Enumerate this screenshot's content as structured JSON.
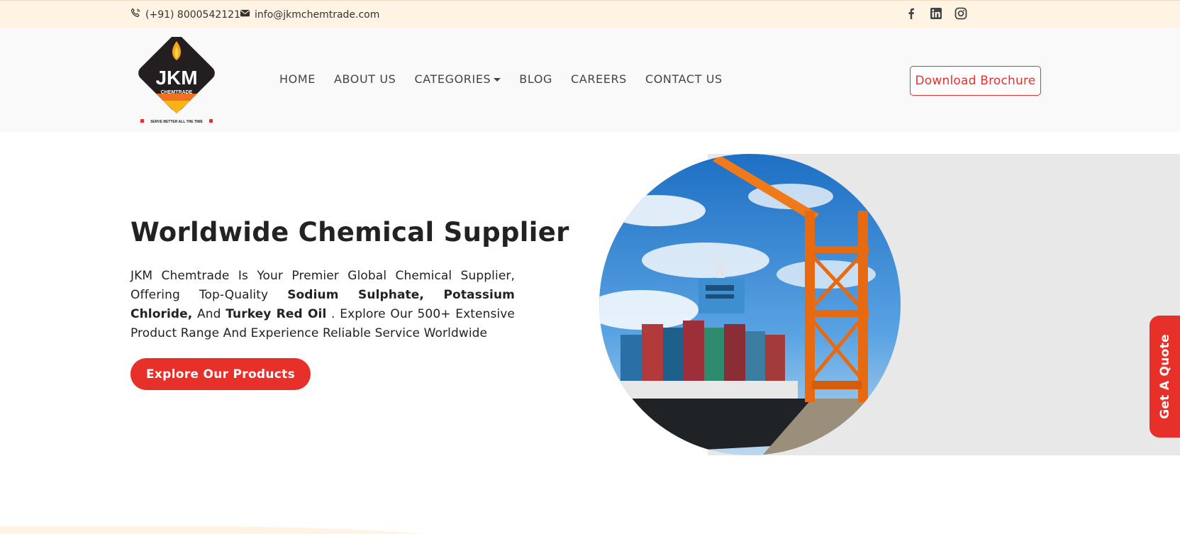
{
  "topbar": {
    "phone": "(+91) 8000542121",
    "email": "info@jkmchemtrade.com",
    "socials": [
      "facebook-icon",
      "linkedin-icon",
      "instagram-icon"
    ]
  },
  "logo": {
    "brand": "JKM",
    "sub": "CHEMTRADE",
    "tagline": "SERVE BETTER ALL THE TIME"
  },
  "nav": {
    "items": [
      {
        "label": "HOME"
      },
      {
        "label": "ABOUT US"
      },
      {
        "label": "CATEGORIES"
      },
      {
        "label": "BLOG"
      },
      {
        "label": "CAREERS"
      },
      {
        "label": "CONTACT US"
      }
    ],
    "brochure_label": "Download Brochure"
  },
  "hero": {
    "title": "Worldwide Chemical Supplier",
    "desc_1": "JKM Chemtrade Is Your Premier Global Chemical Supplier, Offering Top-Quality ",
    "bold_1": "Sodium Sulphate, Potassium Chloride,",
    "desc_2": " And ",
    "bold_2": "Turkey Red Oil",
    "desc_3": " . Explore Our 500+ Extensive Product Range And Experience Reliable Service Worldwide",
    "cta_label": "Explore Our Products"
  },
  "quote_tab": {
    "label": "Get A Quote"
  },
  "colors": {
    "accent": "#e8302a",
    "topbar_bg": "#fff3e3",
    "header_bg": "#f9f9f9",
    "panel_gray": "#e8e8e8"
  }
}
